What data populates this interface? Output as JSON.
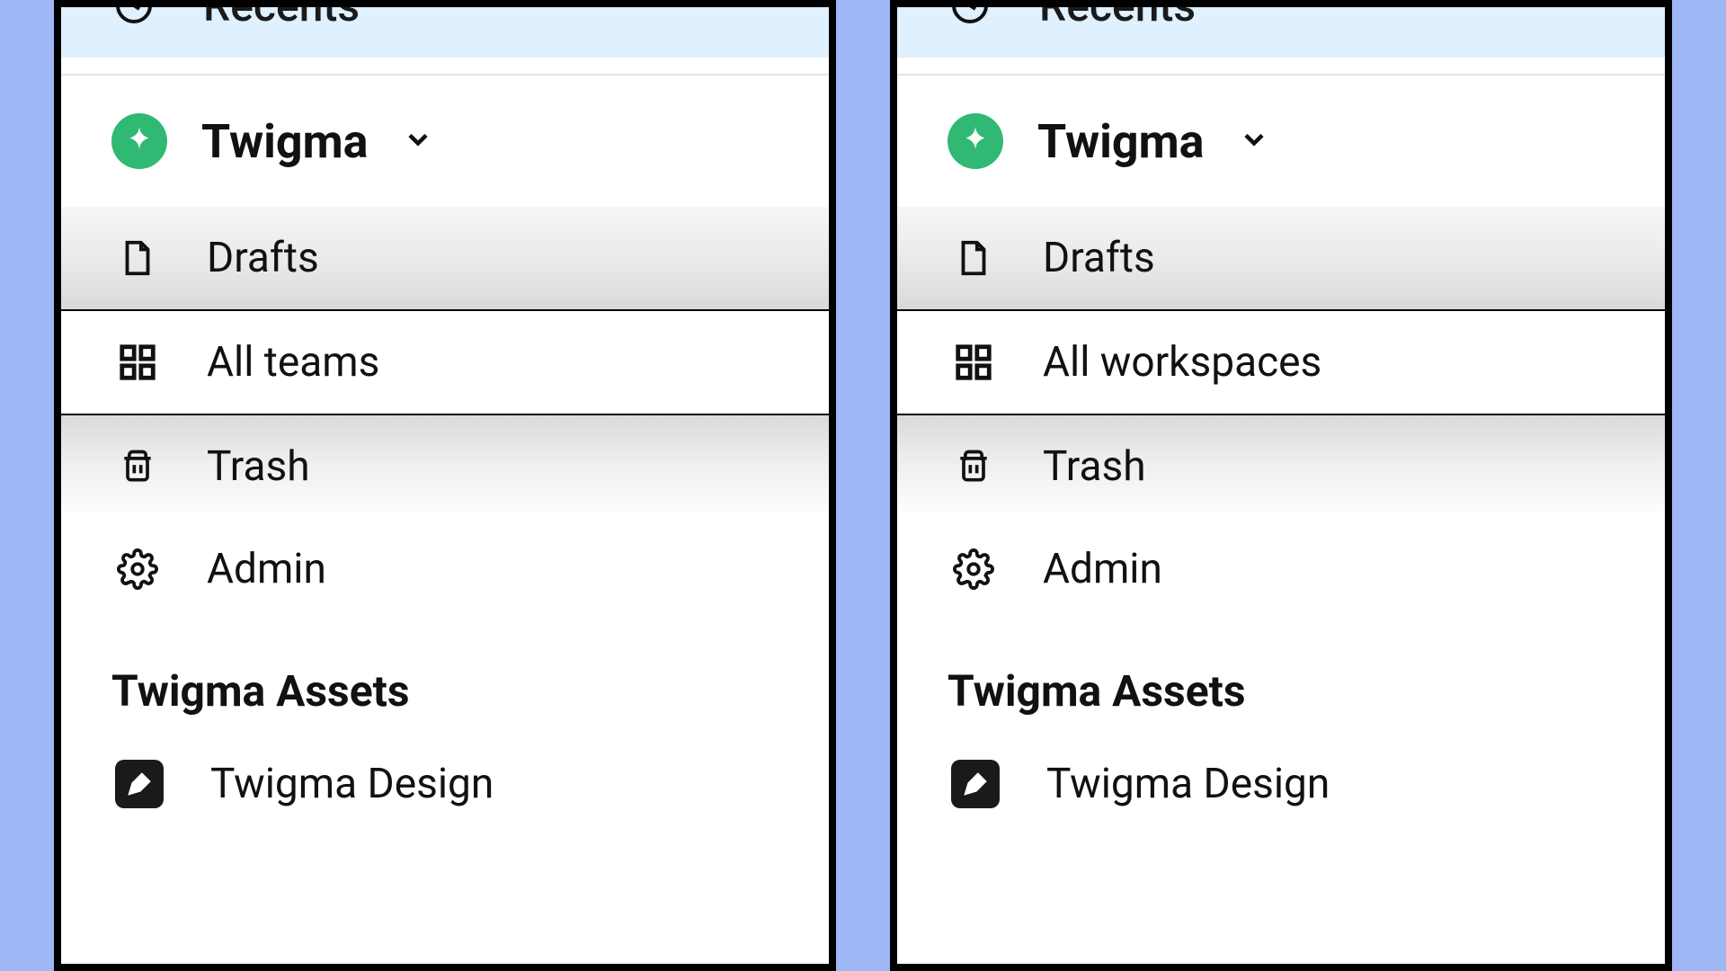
{
  "recents_label": "Recents",
  "org_name": "Twigma",
  "section_title": "Twigma Assets",
  "left": {
    "nav": {
      "drafts": "Drafts",
      "all": "All teams",
      "trash": "Trash",
      "admin": "Admin"
    },
    "asset": "Twigma Design"
  },
  "right": {
    "nav": {
      "drafts": "Drafts",
      "all": "All workspaces",
      "trash": "Trash",
      "admin": "Admin"
    },
    "asset": "Twigma Design"
  }
}
